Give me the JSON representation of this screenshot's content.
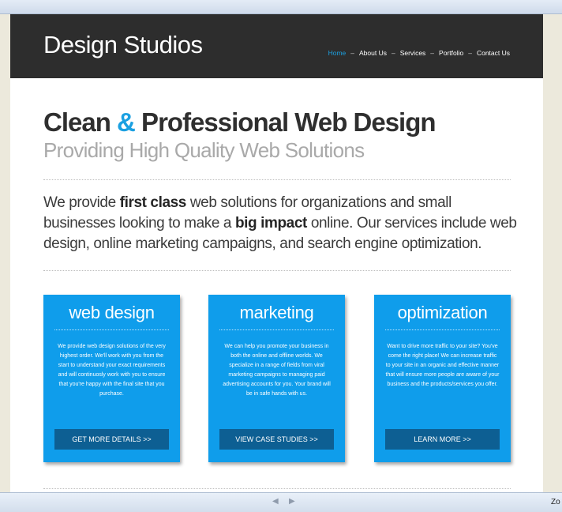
{
  "site": {
    "logo": "Design Studios",
    "nav": [
      {
        "label": "Home"
      },
      {
        "label": "About Us"
      },
      {
        "label": "Services"
      },
      {
        "label": "Portfolio"
      },
      {
        "label": "Contact Us"
      }
    ],
    "nav_separator": "–"
  },
  "hero": {
    "headline_part1": "Clean ",
    "headline_amp": "&",
    "headline_part2": " Professional Web Design",
    "subheadline": "Providing High Quality Web Solutions"
  },
  "intro": {
    "t1": "We provide ",
    "b1": "first class",
    "t2": " web solutions for organizations and small businesses looking to make a ",
    "b2": "big impact",
    "t3": " online. Our services include web design, online marketing campaigns, and search engine optimization."
  },
  "cards": [
    {
      "title": "web design",
      "body": "We provide web design solutions of the very highest order. We'll work with you from the start to understand your exact requirements and will continuosly work with you to ensure that you're happy with the final site that you purchase.",
      "button": "GET MORE DETAILS >>"
    },
    {
      "title": "marketing",
      "body": "We can help you promote your business in both the online and offline worlds. We specialize in a range of fields from viral marketing campaigns to managing paid advertising accounts for you. Your brand will be in safe hands with us.",
      "button": "VIEW CASE STUDIES >>"
    },
    {
      "title": "optimization",
      "body": "Want to drive more traffic to your site? You've come the right place! We can increase traffic to your site in an organic and effective manner that will ensure more people are aware of your business and the products/services you offer.",
      "button": "LEARN MORE >>"
    }
  ],
  "viewer": {
    "prev_glyph": "◀",
    "next_glyph": "▶",
    "zoom_label": "Zo"
  },
  "colors": {
    "accent": "#1ba0e1",
    "card_bg": "#0f9deb",
    "button_bg": "#0d5f93",
    "header_bg": "#2d2d2d"
  }
}
